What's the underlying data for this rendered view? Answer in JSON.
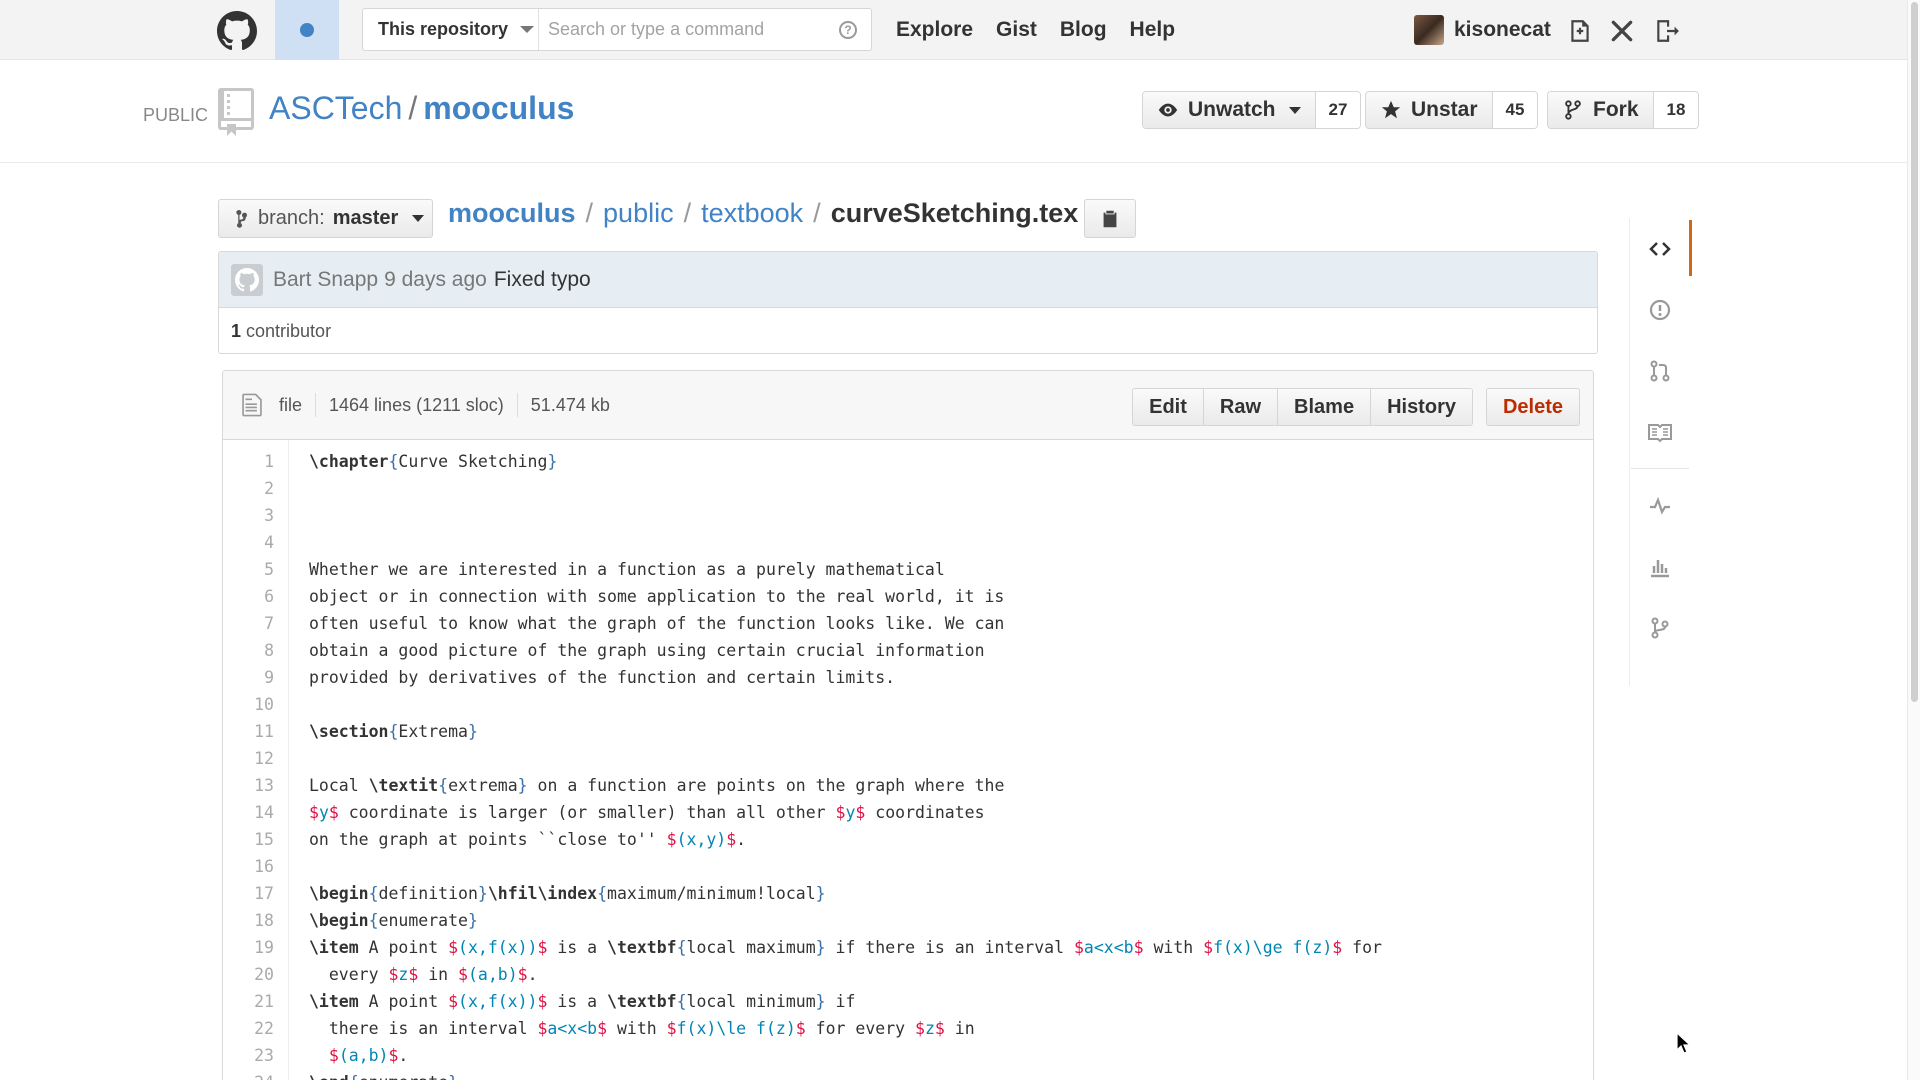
{
  "header": {
    "scope_label": "This repository",
    "search_placeholder": "Search or type a command",
    "nav": [
      "Explore",
      "Gist",
      "Blog",
      "Help"
    ],
    "username": "kisonecat"
  },
  "repo": {
    "visibility": "PUBLIC",
    "owner": "ASCTech",
    "separator": "/",
    "name": "mooculus",
    "watch_label": "Unwatch",
    "watch_count": "27",
    "star_label": "Unstar",
    "star_count": "45",
    "fork_label": "Fork",
    "fork_count": "18"
  },
  "file_nav": {
    "branch_prefix": "branch:",
    "branch_name": "master",
    "crumbs": [
      "mooculus",
      "public",
      "textbook"
    ],
    "file": "curveSketching.tex"
  },
  "commit": {
    "author": "Bart Snapp",
    "time": "9 days ago",
    "message": "Fixed typo",
    "contributor_count": "1",
    "contributor_label": "contributor"
  },
  "file_meta": {
    "type": "file",
    "lines": "1464 lines (1211 sloc)",
    "size": "51.474 kb",
    "actions": [
      "Edit",
      "Raw",
      "Blame",
      "History"
    ],
    "delete": "Delete"
  },
  "code_lines": [
    "\\chapter{Curve Sketching}",
    "",
    "",
    "",
    "Whether we are interested in a function as a purely mathematical",
    "object or in connection with some application to the real world, it is",
    "often useful to know what the graph of the function looks like. We can",
    "obtain a good picture of the graph using certain crucial information",
    "provided by derivatives of the function and certain limits.",
    "",
    "\\section{Extrema}",
    "",
    "Local \\textit{extrema} on a function are points on the graph where the",
    "$y$ coordinate is larger (or smaller) than all other $y$ coordinates",
    "on the graph at points ``close to'' $(x,y)$.",
    "",
    "\\begin{definition}\\hfil\\index{maximum/minimum!local}",
    "\\begin{enumerate}",
    "\\item A point $(x,f(x))$ is a \\textbf{local maximum} if there is an interval $a<x<b$ with $f(x)\\ge f(z)$ for",
    "  every $z$ in $(a,b)$.",
    "\\item A point $(x,f(x))$ is a \\textbf{local minimum} if",
    "  there is an interval $a<x<b$ with $f(x)\\le f(z)$ for every $z$ in",
    "  $(a,b)$.",
    "\\end{enumerate}"
  ],
  "sidebar_icons": [
    "code-icon",
    "issues-icon",
    "pull-requests-icon",
    "wiki-icon",
    "pulse-icon",
    "graphs-icon",
    "network-icon"
  ],
  "colors": {
    "link": "#4183c4",
    "accent_tab": "#d26911",
    "danger": "#bd2c00",
    "math": "#d14"
  }
}
